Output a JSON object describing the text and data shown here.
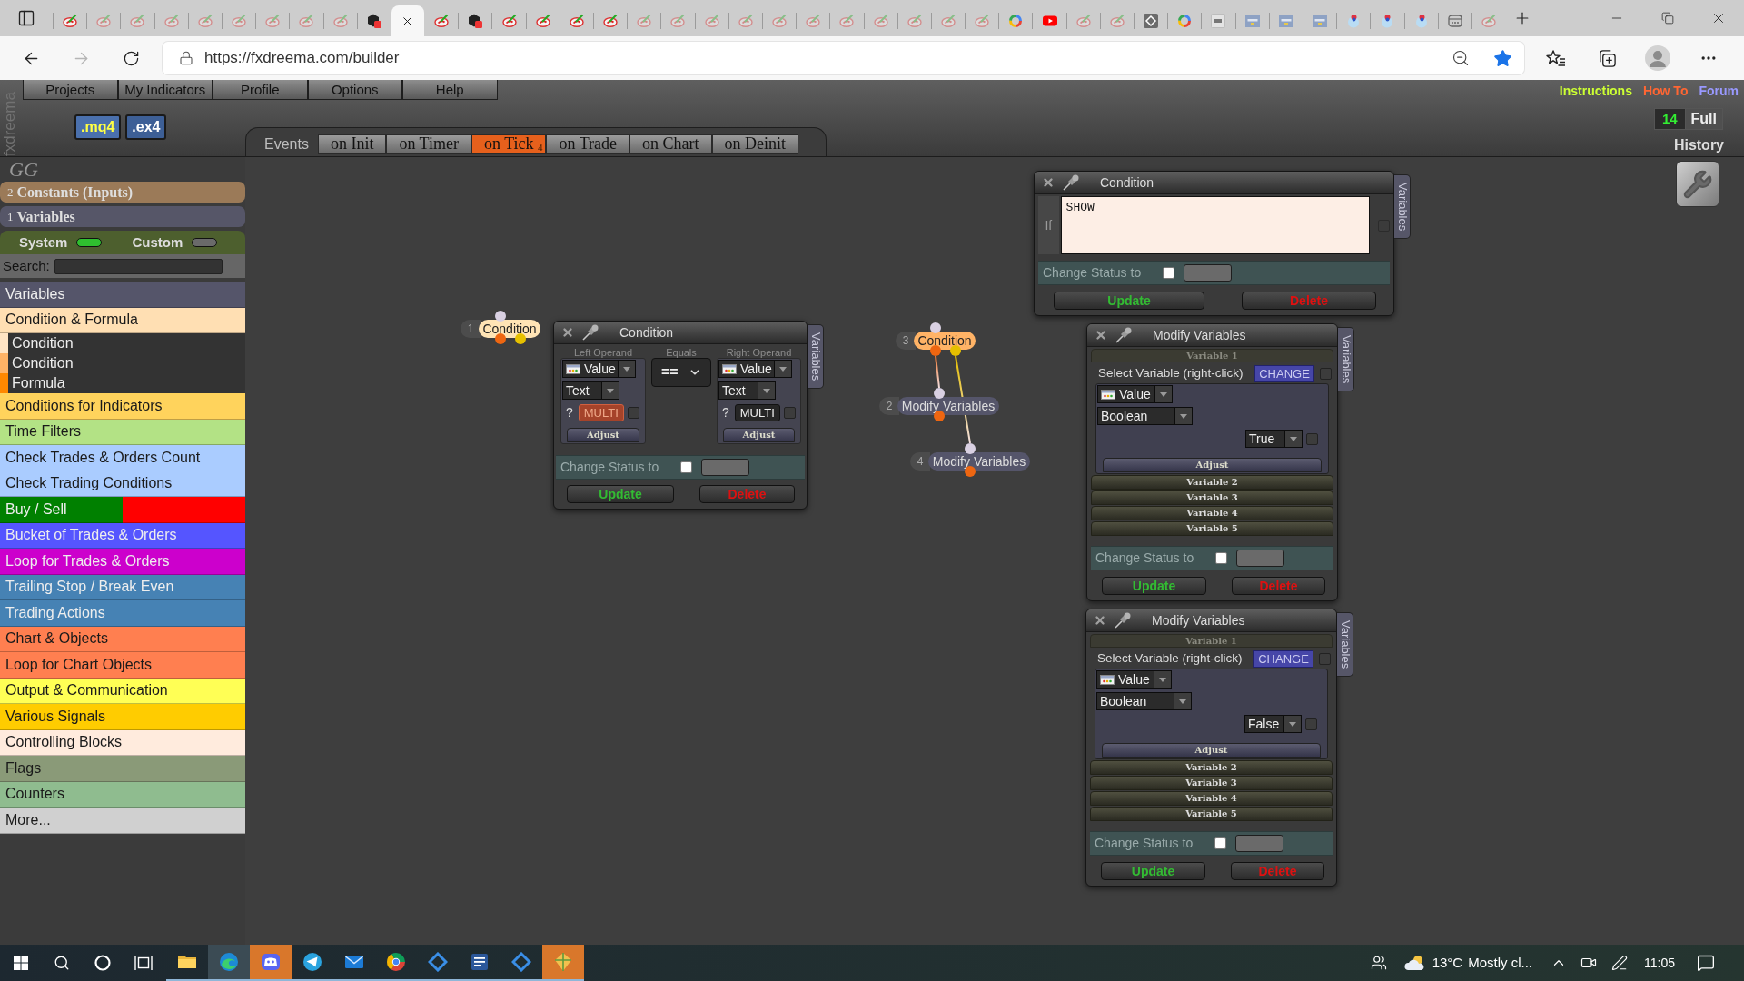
{
  "browser": {
    "tabs": [
      {
        "kind": "pen",
        "dimmed": false,
        "selected": false
      },
      {
        "kind": "pen",
        "dimmed": true,
        "selected": false
      },
      {
        "kind": "pen",
        "dimmed": true,
        "selected": false
      },
      {
        "kind": "pen",
        "dimmed": true,
        "selected": false
      },
      {
        "kind": "pen",
        "dimmed": true,
        "selected": false
      },
      {
        "kind": "pen",
        "dimmed": true,
        "selected": false
      },
      {
        "kind": "pen",
        "dimmed": true,
        "selected": false
      },
      {
        "kind": "pen",
        "dimmed": true,
        "selected": false
      },
      {
        "kind": "pen",
        "dimmed": true,
        "selected": false
      },
      {
        "kind": "hexagon",
        "dimmed": false,
        "selected": false
      },
      {
        "selected": true
      },
      {
        "kind": "pen",
        "dimmed": false,
        "selected": false
      },
      {
        "kind": "hexagon",
        "dimmed": false,
        "selected": false
      },
      {
        "kind": "pen",
        "dimmed": false,
        "selected": false
      },
      {
        "kind": "pen",
        "dimmed": false,
        "selected": false
      },
      {
        "kind": "pen",
        "dimmed": false,
        "selected": false
      },
      {
        "kind": "pen",
        "dimmed": false,
        "selected": false
      },
      {
        "kind": "pen",
        "dimmed": true,
        "selected": false
      },
      {
        "kind": "pen",
        "dimmed": true,
        "selected": false
      },
      {
        "kind": "pen",
        "dimmed": true,
        "selected": false
      },
      {
        "kind": "pen",
        "dimmed": true,
        "selected": false
      },
      {
        "kind": "pen",
        "dimmed": true,
        "selected": false
      },
      {
        "kind": "pen",
        "dimmed": true,
        "selected": false
      },
      {
        "kind": "pen",
        "dimmed": true,
        "selected": false
      },
      {
        "kind": "pen",
        "dimmed": true,
        "selected": false
      },
      {
        "kind": "pen",
        "dimmed": true,
        "selected": false
      },
      {
        "kind": "pen",
        "dimmed": true,
        "selected": false
      },
      {
        "kind": "pen",
        "dimmed": true,
        "selected": false
      },
      {
        "kind": "ring",
        "dimmed": false,
        "selected": false
      },
      {
        "kind": "play",
        "dimmed": false,
        "selected": false
      },
      {
        "kind": "pen",
        "dimmed": true,
        "selected": false
      },
      {
        "kind": "pen",
        "dimmed": true,
        "selected": false
      },
      {
        "kind": "diamond",
        "dimmed": false,
        "selected": false
      },
      {
        "kind": "ring",
        "dimmed": false,
        "selected": false
      },
      {
        "kind": "tile",
        "dimmed": false,
        "selected": false
      },
      {
        "kind": "label-tile",
        "dimmed": false,
        "selected": false
      },
      {
        "kind": "label-tile",
        "dimmed": false,
        "selected": false
      },
      {
        "kind": "label-tile",
        "dimmed": false,
        "selected": false
      },
      {
        "kind": "bubble",
        "dimmed": false,
        "selected": false
      },
      {
        "kind": "bubble",
        "dimmed": false,
        "selected": false
      },
      {
        "kind": "bubble",
        "dimmed": false,
        "selected": false
      },
      {
        "kind": "window",
        "dimmed": false,
        "selected": false
      },
      {
        "kind": "pen",
        "dimmed": true,
        "selected": false
      }
    ],
    "url": "https://fxdreema.com/builder"
  },
  "header": {
    "brand": "fxdreema",
    "menu": [
      "Projects",
      "My Indicators",
      "Profile",
      "Options",
      "Help"
    ],
    "file_buttons": [
      {
        "label": ".mq4",
        "selected": true
      },
      {
        "label": ".ex4",
        "selected": false
      }
    ],
    "events_label": "Events",
    "event_tabs": [
      {
        "label": "on Init",
        "selected": false
      },
      {
        "label": "on Timer",
        "selected": false
      },
      {
        "label": "on Tick",
        "selected": true,
        "count": "4"
      },
      {
        "label": "on Trade",
        "selected": false
      },
      {
        "label": "on Chart",
        "selected": false
      },
      {
        "label": "on Deinit",
        "selected": false
      }
    ],
    "links": [
      {
        "label": "Instructions",
        "color": "#ccff33"
      },
      {
        "label": "How To",
        "color": "#ff6633"
      },
      {
        "label": "Forum",
        "color": "#9999ff"
      }
    ],
    "history": {
      "count": "14",
      "mode": "Full",
      "label": "History"
    }
  },
  "sidebar": {
    "logo": "GG",
    "constants": {
      "count": "2",
      "label": "Constants (Inputs)"
    },
    "variables": {
      "count": "1",
      "label": "Variables"
    },
    "toggles": [
      {
        "label": "System",
        "on": true
      },
      {
        "label": "Custom",
        "on": false
      }
    ],
    "search": {
      "label": "Search:"
    },
    "categories": [
      {
        "label": "Variables",
        "color": "#55556a"
      },
      {
        "label": "Condition & Formula",
        "color": "#ffdfb3",
        "expanded": true,
        "children": [
          {
            "label": "Condition",
            "color": "#ffe4c4"
          },
          {
            "label": "Condition",
            "color": "#ffb366"
          },
          {
            "label": "Formula",
            "color": "#ff8800"
          }
        ]
      },
      {
        "label": "Conditions for Indicators",
        "color": "#ffd35c"
      },
      {
        "label": "Time Filters",
        "color": "#b3e285"
      },
      {
        "label": "Check Trades & Orders Count",
        "color": "#aaccff"
      },
      {
        "label": "Check Trading Conditions",
        "color": "#aaccff"
      },
      {
        "label": "Buy / Sell",
        "color": "#008000",
        "split": {
          "color": "#ff0000"
        }
      },
      {
        "label": "Bucket of Trades & Orders",
        "color": "#5555ff"
      },
      {
        "label": "Loop for Trades & Orders",
        "color": "#cc00cc"
      },
      {
        "label": "Trailing Stop / Break Even",
        "color": "#4682b4"
      },
      {
        "label": "Trading Actions",
        "color": "#4682b4"
      },
      {
        "label": "Chart & Objects",
        "color": "#ff7f50"
      },
      {
        "label": "Loop for Chart Objects",
        "color": "#ff7f50"
      },
      {
        "label": "Output & Communication",
        "color": "#ffff55"
      },
      {
        "label": "Various Signals",
        "color": "#ffcc00"
      },
      {
        "label": "Controlling Blocks",
        "color": "#ffebdd"
      },
      {
        "label": "Flags",
        "color": "#8a9a78"
      },
      {
        "label": "Counters",
        "color": "#8fbc8f"
      },
      {
        "label": "More...",
        "color": "#d0d0d0"
      }
    ]
  },
  "canvas": {
    "nodes": [
      {
        "number": "1",
        "label": "Condition",
        "kind": "condition",
        "color": "#ffe4b5"
      },
      {
        "number": "3",
        "label": "Condition",
        "kind": "condition",
        "color": "#ffb366"
      },
      {
        "number": "2",
        "label": "Modify Variables",
        "kind": "action",
        "color": "#55556a"
      },
      {
        "number": "4",
        "label": "Modify Variables",
        "kind": "action",
        "color": "#55556a"
      }
    ],
    "windows": [
      {
        "kind": "formula",
        "title": "Condition",
        "side_tab": "Variables",
        "if_label": "If",
        "formula": "SHOW",
        "checked": false,
        "status": {
          "label": "Change Status to",
          "checked": false
        },
        "buttons": [
          {
            "label": "Update",
            "kind": "confirm"
          },
          {
            "label": "Delete",
            "kind": "danger"
          }
        ]
      },
      {
        "kind": "operands",
        "title": "Condition",
        "side_tab": "Variables",
        "column_labels": [
          "Left Operand",
          "Equals",
          "Right Operand"
        ],
        "operands": [
          {
            "type": "Value",
            "data_type": "Text",
            "hint": "?",
            "multi": "MULTI",
            "multi_on": true,
            "checked": false,
            "adjust": "Adjust"
          },
          {
            "type": "Value",
            "data_type": "Text",
            "hint": "?",
            "multi": "MULTI",
            "multi_on": false,
            "checked": false,
            "adjust": "Adjust"
          }
        ],
        "comparator": "==",
        "status": {
          "label": "Change Status to",
          "checked": false
        },
        "buttons": [
          {
            "label": "Update",
            "kind": "confirm"
          },
          {
            "label": "Delete",
            "kind": "danger"
          }
        ]
      },
      {
        "kind": "modify",
        "title": "Modify Variables",
        "side_tab": "Variables",
        "variables": [
          {
            "label": "Variable 1",
            "expanded": true,
            "select_label": "Select Variable (right-click)",
            "change": "CHANGE",
            "checked": false,
            "type": "Value",
            "data_type": "Boolean",
            "value": "True",
            "value_checked": false,
            "adjust": "Adjust"
          },
          {
            "label": "Variable 2",
            "expanded": false
          },
          {
            "label": "Variable 3",
            "expanded": false
          },
          {
            "label": "Variable 4",
            "expanded": false
          },
          {
            "label": "Variable 5",
            "expanded": false
          }
        ],
        "status": {
          "label": "Change Status to",
          "checked": false
        },
        "buttons": [
          {
            "label": "Update",
            "kind": "confirm"
          },
          {
            "label": "Delete",
            "kind": "danger"
          }
        ]
      },
      {
        "kind": "modify",
        "title": "Modify Variables",
        "side_tab": "Variables",
        "variables": [
          {
            "label": "Variable 1",
            "expanded": true,
            "select_label": "Select Variable (right-click)",
            "change": "CHANGE",
            "checked": false,
            "type": "Value",
            "data_type": "Boolean",
            "value": "False",
            "value_checked": false,
            "adjust": "Adjust"
          },
          {
            "label": "Variable 2",
            "expanded": false
          },
          {
            "label": "Variable 3",
            "expanded": false
          },
          {
            "label": "Variable 4",
            "expanded": false
          },
          {
            "label": "Variable 5",
            "expanded": false
          }
        ],
        "status": {
          "label": "Change Status to",
          "checked": false
        },
        "buttons": [
          {
            "label": "Update",
            "kind": "confirm"
          },
          {
            "label": "Delete",
            "kind": "danger"
          }
        ]
      }
    ]
  },
  "taskbar": {
    "apps": [
      {
        "kind": "folder",
        "running": true,
        "selected": false,
        "flashing": false
      },
      {
        "kind": "swirl",
        "running": true,
        "selected": true,
        "flashing": false
      },
      {
        "kind": "controller",
        "running": true,
        "selected": false,
        "flashing": true
      },
      {
        "kind": "paper-plane",
        "running": true,
        "selected": false,
        "flashing": false
      },
      {
        "kind": "envelope",
        "running": true,
        "selected": false,
        "flashing": false
      },
      {
        "kind": "ring",
        "running": true,
        "selected": false,
        "flashing": false
      },
      {
        "kind": "diamond",
        "running": true,
        "selected": false,
        "flashing": false
      },
      {
        "kind": "document",
        "running": true,
        "selected": false,
        "flashing": false
      },
      {
        "kind": "diamond",
        "running": true,
        "selected": false,
        "flashing": false
      },
      {
        "kind": "kite",
        "running": true,
        "selected": false,
        "flashing": true
      }
    ],
    "weather": {
      "temperature": "13°C",
      "summary": "Mostly cl..."
    },
    "time": "11:05"
  }
}
